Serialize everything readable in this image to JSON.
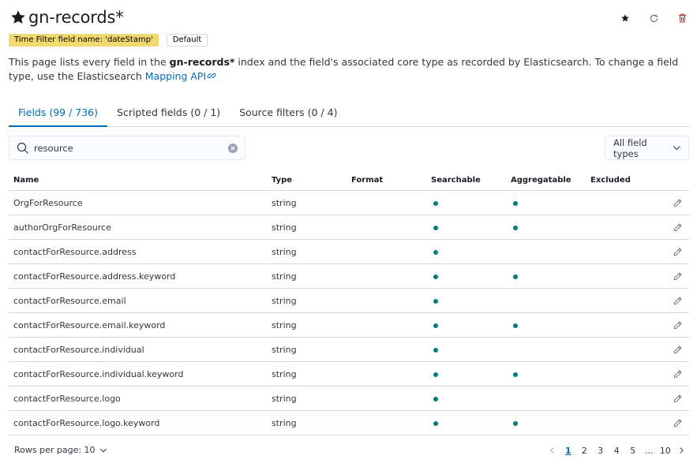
{
  "header": {
    "title": "gn-records*"
  },
  "badges": {
    "time_filter": "Time Filter field name: 'dateStamp'",
    "default": "Default"
  },
  "description": {
    "prefix": "This page lists every field in the ",
    "index_name": "gn-records*",
    "suffix": " index and the field's associated core type as recorded by Elasticsearch. To change a field type, use the Elasticsearch ",
    "link": "Mapping API"
  },
  "tabs": [
    {
      "label": "Fields (99 / 736)",
      "active": true
    },
    {
      "label": "Scripted fields (0 / 1)",
      "active": false
    },
    {
      "label": "Source filters (0 / 4)",
      "active": false
    }
  ],
  "search": {
    "value": "resource"
  },
  "filter": {
    "label": "All field types"
  },
  "table": {
    "columns": [
      "Name",
      "Type",
      "Format",
      "Searchable",
      "Aggregatable",
      "Excluded"
    ],
    "rows": [
      {
        "name": "OrgForResource",
        "type": "string",
        "format": "",
        "searchable": true,
        "aggregatable": true,
        "excluded": false
      },
      {
        "name": "authorOrgForResource",
        "type": "string",
        "format": "",
        "searchable": true,
        "aggregatable": true,
        "excluded": false
      },
      {
        "name": "contactForResource.address",
        "type": "string",
        "format": "",
        "searchable": true,
        "aggregatable": false,
        "excluded": false
      },
      {
        "name": "contactForResource.address.keyword",
        "type": "string",
        "format": "",
        "searchable": true,
        "aggregatable": true,
        "excluded": false
      },
      {
        "name": "contactForResource.email",
        "type": "string",
        "format": "",
        "searchable": true,
        "aggregatable": false,
        "excluded": false
      },
      {
        "name": "contactForResource.email.keyword",
        "type": "string",
        "format": "",
        "searchable": true,
        "aggregatable": true,
        "excluded": false
      },
      {
        "name": "contactForResource.individual",
        "type": "string",
        "format": "",
        "searchable": true,
        "aggregatable": false,
        "excluded": false
      },
      {
        "name": "contactForResource.individual.keyword",
        "type": "string",
        "format": "",
        "searchable": true,
        "aggregatable": true,
        "excluded": false
      },
      {
        "name": "contactForResource.logo",
        "type": "string",
        "format": "",
        "searchable": true,
        "aggregatable": false,
        "excluded": false
      },
      {
        "name": "contactForResource.logo.keyword",
        "type": "string",
        "format": "",
        "searchable": true,
        "aggregatable": true,
        "excluded": false
      }
    ]
  },
  "footer": {
    "rows_per_page": "Rows per page: 10",
    "pages": [
      "1",
      "2",
      "3",
      "4",
      "5",
      "...",
      "10"
    ],
    "current_page": "1"
  },
  "colors": {
    "accent": "#006bb8",
    "dot": "#017d73",
    "badge": "#f1d86f",
    "danger": "#bd271e"
  },
  "icons": {
    "title": "star-filled-icon",
    "actions": [
      "star-filled-icon",
      "refresh-icon",
      "trash-icon"
    ],
    "search": "search-icon",
    "clear": "clear-icon",
    "filter": "chevron-down-icon",
    "row_action": "pencil-icon",
    "link": "external-link-icon"
  }
}
